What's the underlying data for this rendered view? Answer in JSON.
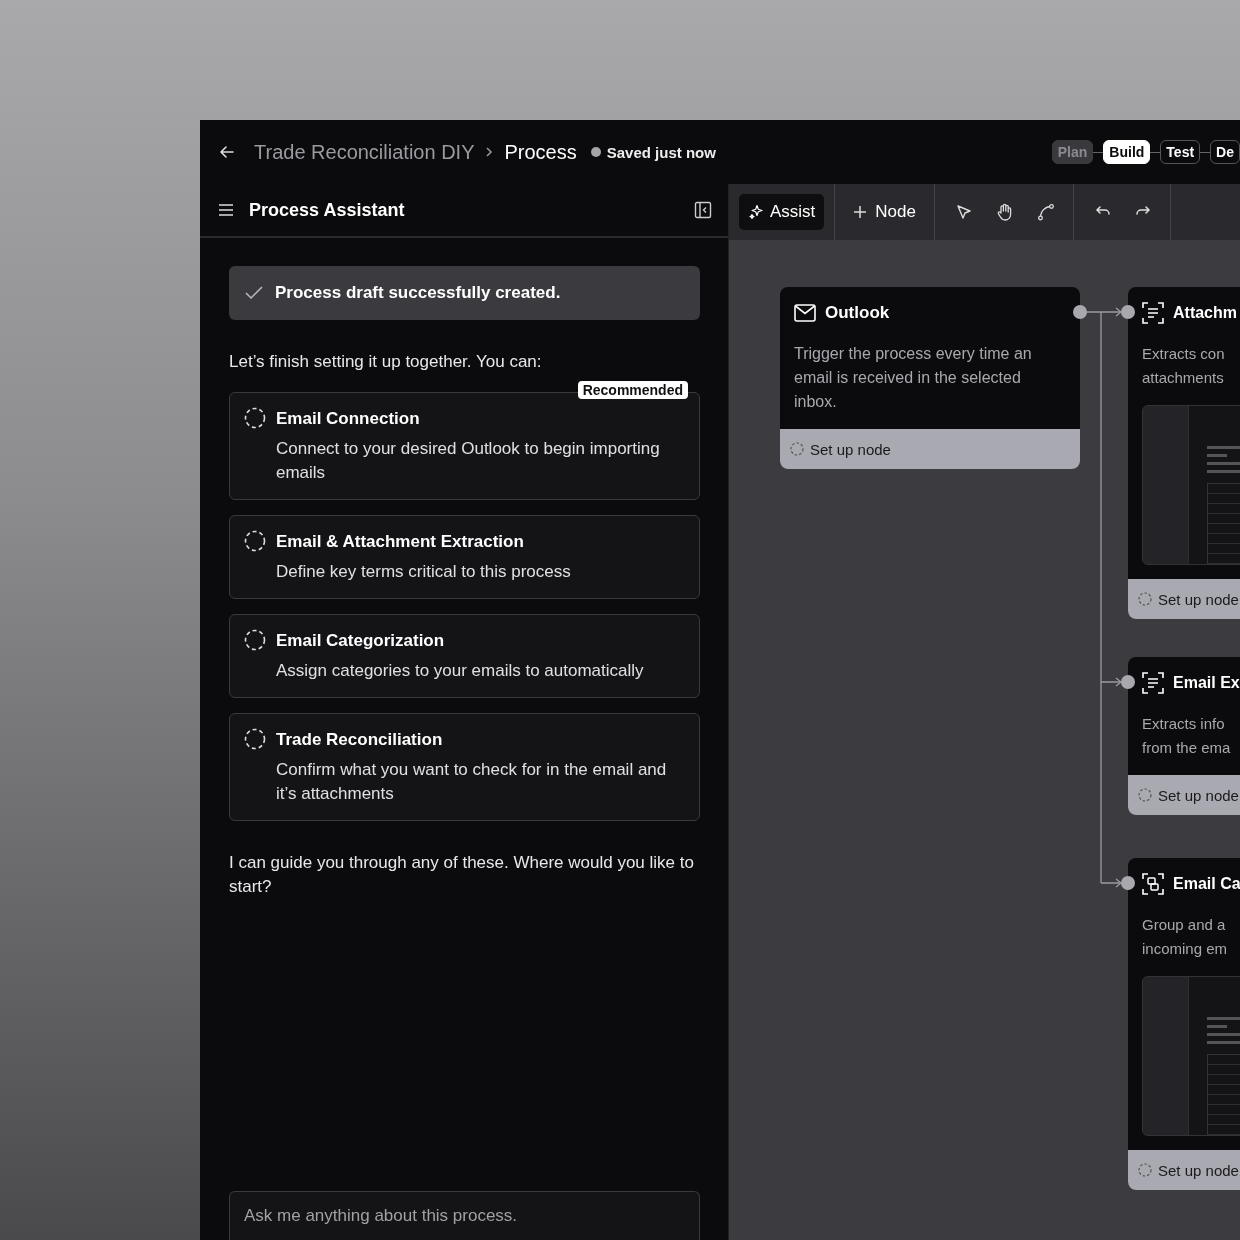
{
  "header": {
    "breadcrumb": [
      "Trade Reconciliation DIY",
      "Process"
    ],
    "save_status": "Saved just now",
    "steps": [
      {
        "label": "Plan",
        "selected": false,
        "completed": true
      },
      {
        "label": "Build",
        "selected": true,
        "completed": false
      },
      {
        "label": "Test",
        "selected": false,
        "completed": false
      },
      {
        "label": "De",
        "selected": false,
        "completed": false
      }
    ]
  },
  "assistant": {
    "title": "Process Assistant",
    "toast": "Process draft successfully created.",
    "intro": "Let’s finish setting it up together. You can:",
    "tasks": [
      {
        "title": "Email Connection",
        "description": "Connect to your desired Outlook to begin importing emails",
        "badge": "Recommended"
      },
      {
        "title": "Email & Attachment Extraction",
        "description": "Define key terms critical to this process"
      },
      {
        "title": "Email Categorization",
        "description": "Assign categories to your emails to automatically"
      },
      {
        "title": "Trade Reconciliation",
        "description": "Confirm what you want to check for in the email and it’s attachments"
      }
    ],
    "outro": "I can guide you through any of these. Where would you like to start?",
    "input_placeholder": "Ask me anything about this process."
  },
  "toolbar": {
    "assist": "Assist",
    "node": "Node"
  },
  "nodes": [
    {
      "kind": "trigger",
      "title": "Outlook",
      "lines": [
        "Trigger the process every time an",
        "email is received in the selected",
        "inbox."
      ],
      "preview": false,
      "action": "Set up node"
    },
    {
      "kind": "extract",
      "title": "Attachm",
      "lines": [
        "Extracts con",
        "attachments"
      ],
      "preview": true,
      "action": "Set up node"
    },
    {
      "kind": "extract",
      "title": "Email Ex",
      "lines": [
        "Extracts info",
        "from the ema"
      ],
      "preview": false,
      "action": "Set up node"
    },
    {
      "kind": "categorize",
      "title": "Email Ca",
      "lines": [
        "Group and a",
        "incoming em"
      ],
      "preview": true,
      "action": "Set up node"
    }
  ]
}
